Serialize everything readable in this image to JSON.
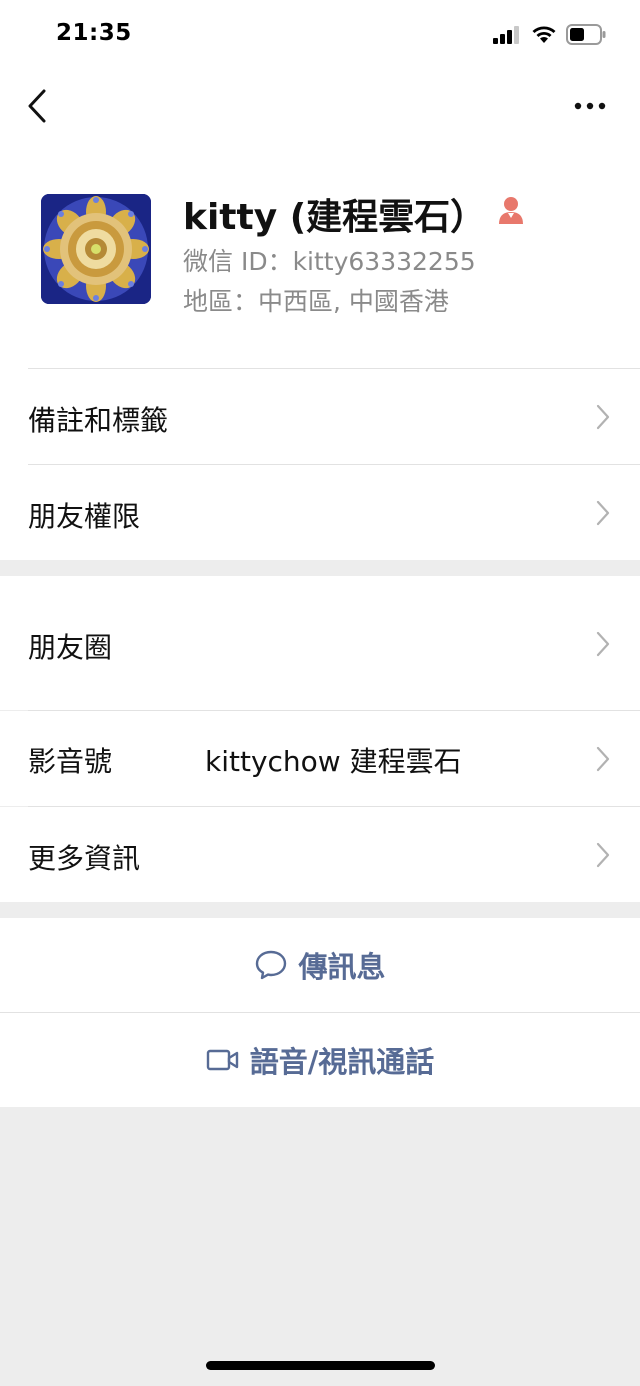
{
  "status_bar": {
    "time": "21:35"
  },
  "profile": {
    "name": "kitty (建程雲石）",
    "wechat_id": "微信 ID：kitty63332255",
    "region": "地區：中西區, 中國香港",
    "gender_icon": "female-person-icon",
    "gender_color": "#e8786c"
  },
  "menu": {
    "remarks_tags": "備註和標籤",
    "friend_permissions": "朋友權限",
    "moments": "朋友圈",
    "channels": "影音號",
    "channels_value": "kittychow 建程雲石",
    "more_info": "更多資訊"
  },
  "actions": {
    "send_message": "傳訊息",
    "voice_video_call": "語音/視訊通話",
    "link_color": "#576b95"
  }
}
